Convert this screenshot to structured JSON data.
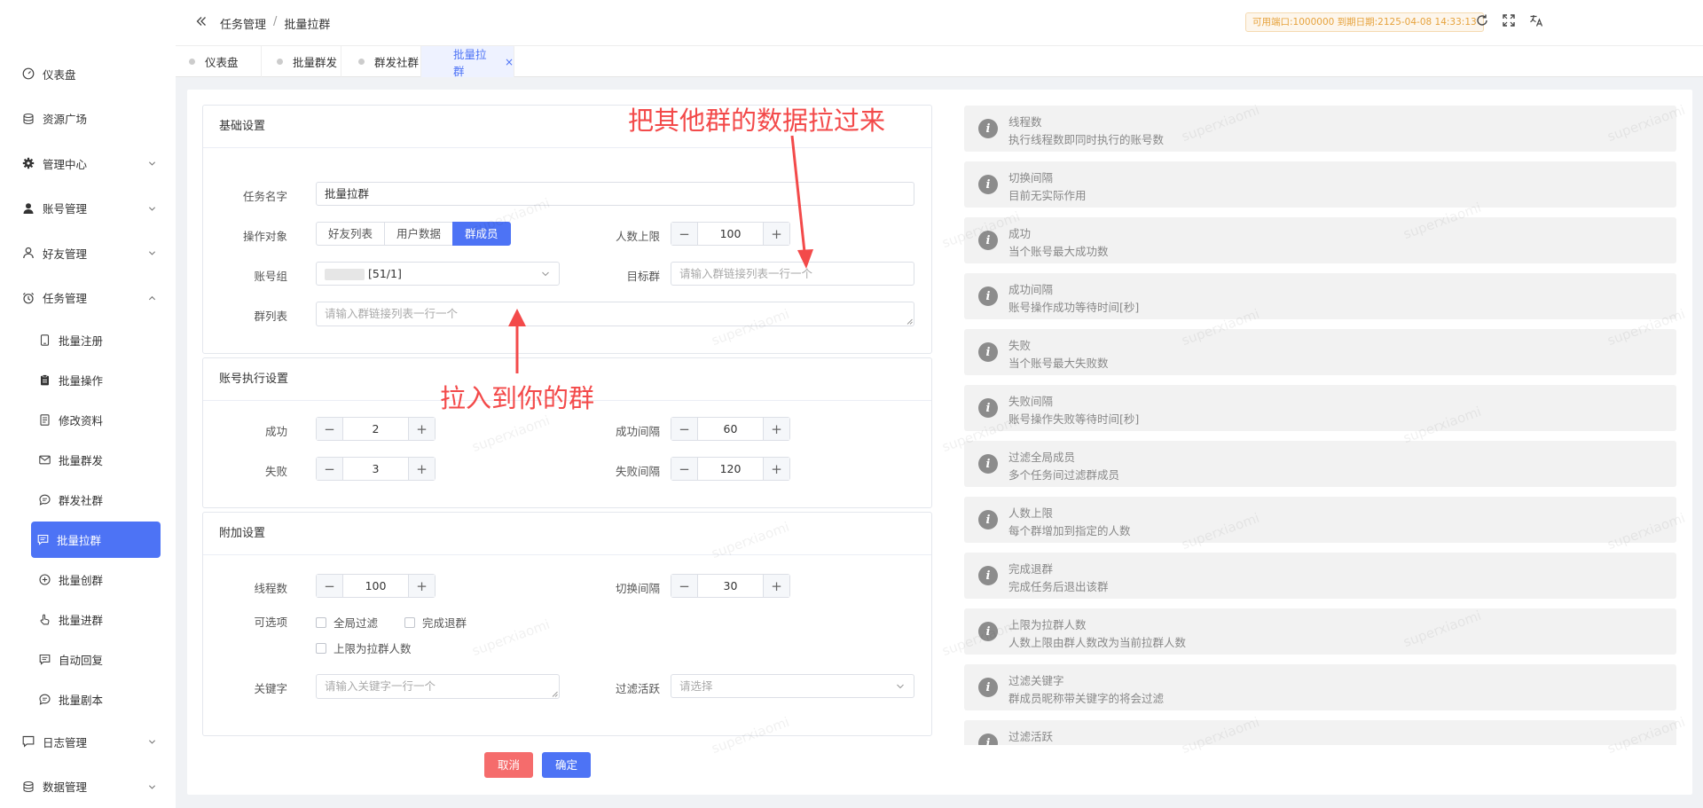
{
  "sidebar": {
    "items": [
      {
        "label": "仪表盘"
      },
      {
        "label": "资源广场"
      },
      {
        "label": "管理中心"
      },
      {
        "label": "账号管理"
      },
      {
        "label": "好友管理"
      },
      {
        "label": "任务管理"
      }
    ],
    "sub_items": [
      {
        "label": "批量注册"
      },
      {
        "label": "批量操作"
      },
      {
        "label": "修改资料"
      },
      {
        "label": "批量群发"
      },
      {
        "label": "群发社群"
      },
      {
        "label": "批量拉群"
      },
      {
        "label": "批量创群"
      },
      {
        "label": "批量进群"
      },
      {
        "label": "自动回复"
      },
      {
        "label": "批量剧本"
      }
    ],
    "bottom_items": [
      {
        "label": "日志管理"
      },
      {
        "label": "数据管理"
      }
    ]
  },
  "header": {
    "breadcrumb": [
      "任务管理",
      "/",
      "批量拉群"
    ],
    "expiry": "可用端口:1000000 到期日期:2125-04-08 14:33:13"
  },
  "tabs": [
    {
      "label": "仪表盘"
    },
    {
      "label": "批量群发"
    },
    {
      "label": "群发社群"
    },
    {
      "label": "批量拉群",
      "close": "×"
    }
  ],
  "basic": {
    "title": "基础设置",
    "task_name_label": "任务名字",
    "task_name_value": "批量拉群",
    "target_label": "操作对象",
    "target_options": [
      "好友列表",
      "用户数据",
      "群成员"
    ],
    "max_label": "人数上限",
    "max_value": "100",
    "group_label": "账号组",
    "group_value": "[51/1]",
    "dest_label": "目标群",
    "dest_placeholder": "请输入群链接列表一行一个",
    "list_label": "群列表",
    "list_placeholder": "请输入群链接列表一行一个"
  },
  "exec": {
    "title": "账号执行设置",
    "success_label": "成功",
    "success_value": "2",
    "success_interval_label": "成功间隔",
    "success_interval_value": "60",
    "fail_label": "失败",
    "fail_value": "3",
    "fail_interval_label": "失败间隔",
    "fail_interval_value": "120"
  },
  "extra": {
    "title": "附加设置",
    "threads_label": "线程数",
    "threads_value": "100",
    "switch_label": "切换间隔",
    "switch_value": "30",
    "options_label": "可选项",
    "opt_global": "全局过滤",
    "opt_quit": "完成退群",
    "opt_limit": "上限为拉群人数",
    "keyword_label": "关键字",
    "keyword_placeholder": "请输入关键字一行一个",
    "active_label": "过滤活跃",
    "active_placeholder": "请选择"
  },
  "buttons": {
    "minus": "−",
    "plus": "+",
    "cancel": "取消",
    "confirm": "确定"
  },
  "colors": {
    "primary": "#4d73f5",
    "danger": "#f56c6c",
    "annotation": "#f34a4a",
    "warning": "#e6a23c"
  },
  "annotations": {
    "top": "把其他群的数据拉过来",
    "middle": "拉入到你的群"
  },
  "info_panels": [
    {
      "title": "线程数",
      "desc": "执行线程数即同时执行的账号数"
    },
    {
      "title": "切换间隔",
      "desc": "目前无实际作用"
    },
    {
      "title": "成功",
      "desc": "当个账号最大成功数"
    },
    {
      "title": "成功间隔",
      "desc": "账号操作成功等待时间[秒]"
    },
    {
      "title": "失败",
      "desc": "当个账号最大失败数"
    },
    {
      "title": "失败间隔",
      "desc": "账号操作失败等待时间[秒]"
    },
    {
      "title": "过滤全局成员",
      "desc": "多个任务间过滤群成员"
    },
    {
      "title": "人数上限",
      "desc": "每个群增加到指定的人数"
    },
    {
      "title": "完成退群",
      "desc": "完成任务后退出该群"
    },
    {
      "title": "上限为拉群人数",
      "desc": "人数上限由群人数改为当前拉群人数"
    },
    {
      "title": "过滤关键字",
      "desc": "群成员昵称带关键字的将会过滤"
    },
    {
      "title": "过滤活跃",
      "desc": ""
    }
  ],
  "watermark": "superxiaomi"
}
